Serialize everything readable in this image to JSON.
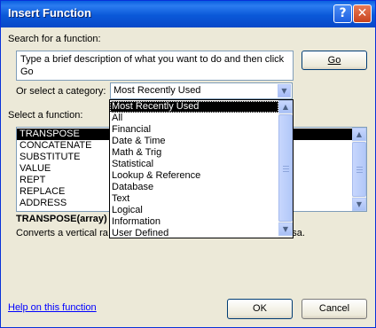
{
  "window": {
    "title": "Insert Function",
    "help_glyph": "?",
    "close_glyph": "✕"
  },
  "search": {
    "label": "Search for a function:",
    "value_line1": "Type a brief description of what you want to do and then click",
    "value_line2": "Go",
    "go_label": "Go"
  },
  "category": {
    "label": "Or select a category:",
    "selected": "Most Recently Used",
    "options": [
      "Most Recently Used",
      "All",
      "Financial",
      "Date & Time",
      "Math & Trig",
      "Statistical",
      "Lookup & Reference",
      "Database",
      "Text",
      "Logical",
      "Information",
      "User Defined"
    ]
  },
  "functions": {
    "label": "Select a function:",
    "items": [
      "TRANSPOSE",
      "CONCATENATE",
      "SUBSTITUTE",
      "VALUE",
      "REPT",
      "REPLACE",
      "ADDRESS"
    ],
    "selected_index": 0
  },
  "detail": {
    "syntax": "TRANSPOSE(array)",
    "description_start": "Converts a vertical ra",
    "description_end": "versa."
  },
  "footer": {
    "help_link": "Help on this function",
    "ok_label": "OK",
    "cancel_label": "Cancel"
  },
  "colors": {
    "titlebar": "#0a5fe0",
    "face": "#ece9d8",
    "selection": "#000000",
    "link": "#0000ff"
  }
}
